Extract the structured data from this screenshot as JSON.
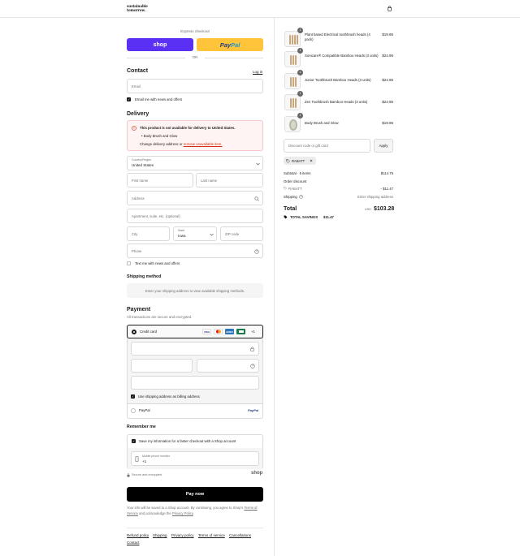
{
  "header": {
    "logo_line1": "sustainable",
    "logo_line2": "tomorrow."
  },
  "express": {
    "title": "Express checkout",
    "shop_label": "shop",
    "paypal_label_1": "Pay",
    "paypal_label_2": "Pal",
    "or_label": "OR"
  },
  "contact": {
    "title": "Contact",
    "login_label": "Log in",
    "email_placeholder": "Email",
    "news_label": "Email me with news and offers"
  },
  "delivery": {
    "title": "Delivery",
    "alert_title": "This product is not available for delivery to United States.",
    "alert_item": "Body Brush and Glow",
    "alert_text": "Change delivery address or",
    "alert_link": "remove unavailable item.",
    "country_label": "Country/Region",
    "country_value": "United States",
    "first_name": "First name",
    "last_name": "Last name",
    "address": "Address",
    "apartment": "Apartment, suite, etc. (optional)",
    "city": "City",
    "state_label": "State",
    "state_value": "Iowa",
    "zip": "ZIP code",
    "phone": "Phone",
    "text_label": "Text me with news and offers"
  },
  "shipping": {
    "title": "Shipping method",
    "note": "Enter your shipping address to view available shipping methods."
  },
  "payment": {
    "title": "Payment",
    "subtitle": "All transactions are secure and encrypted.",
    "credit_card": "Credit card",
    "brands": [
      "VISA",
      "MC",
      "AMEX",
      "",
      "+1"
    ],
    "billing_label": "Use shipping address as billing address",
    "paypal_label": "PayPal",
    "paypal_logo": "PayPal"
  },
  "remember": {
    "title": "Remember me",
    "save_label": "Save my information for a faster checkout with a Shop account",
    "phone_label": "Mobile phone number",
    "phone_value": "+1",
    "secure": "Secure and encrypted",
    "shop_brand": "shop"
  },
  "pay_button": "Pay now",
  "legal": {
    "text1": "Your info will be saved to a Shop account. By continuing, you agree to Shop's",
    "terms": "Terms of Service",
    "text2": "and acknowledge the",
    "privacy": "Privacy Policy",
    "end": "."
  },
  "footer_links": [
    "Refund policy",
    "Shipping",
    "Privacy policy",
    "Terms of service",
    "Cancellations",
    "Contact"
  ],
  "cart": {
    "items": [
      {
        "name": "Plant based Electrical toothbrush heads (4 pack)",
        "price": "$19.95",
        "qty": "1"
      },
      {
        "name": "Sonicare® Compatible Bamboo Heads (3 units)",
        "price": "$24.95",
        "qty": "1"
      },
      {
        "name": "Junior Toothbrush Bamboo Heads (3 units)",
        "price": "$24.95",
        "qty": "1"
      },
      {
        "name": "Zen Toothbrush Bamboo Heads (3 units)",
        "price": "$24.95",
        "qty": "1"
      },
      {
        "name": "Body Brush and Glow",
        "price": "$19.95",
        "qty": "1"
      }
    ],
    "discount_placeholder": "Discount code or gift card",
    "apply": "Apply",
    "code_chip": "RABATT",
    "subtotal_label": "Subtotal · 5 items",
    "subtotal_value": "$114.75",
    "order_discount_label": "Order discount",
    "code_label": "RABATT",
    "discount_value": "- $11.47",
    "shipping_label": "Shipping",
    "shipping_value": "Enter shipping address",
    "total_label": "Total",
    "currency": "USD",
    "total_value": "$103.28",
    "savings_label": "TOTAL SAVINGS",
    "savings_value": "$11.47"
  },
  "colors": {
    "shop_purple": "#5a31f4",
    "paypal_yellow": "#ffc439",
    "alert_red": "#d72c0d"
  }
}
